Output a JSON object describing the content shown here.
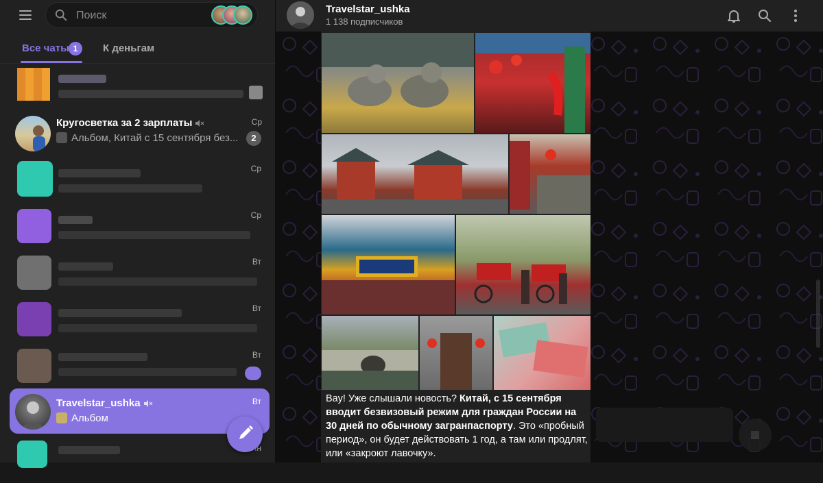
{
  "sidebar": {
    "search_placeholder": "Поиск",
    "tabs": [
      {
        "label": "Все чаты",
        "badge": "1"
      },
      {
        "label": "К деньгам"
      }
    ],
    "chats": [
      {
        "title": "Кругосветка за 2 зарплаты",
        "preview": "Альбом, Китай с 15 сентября без...",
        "time": "Ср",
        "unread": "2",
        "muted": true
      },
      {
        "title": "Travelstar_ushka",
        "preview": "Альбом",
        "time": "Вт",
        "muted": true,
        "active": true
      }
    ],
    "blurred_times": [
      "Ср",
      "Ср",
      "Вт",
      "Вт",
      "Вт",
      "Ин"
    ]
  },
  "header": {
    "title": "Travelstar_ushka",
    "subtitle": "1 138 подписчиков",
    "icons": [
      "bell-icon",
      "search-icon",
      "more-vertical-icon"
    ]
  },
  "message": {
    "caption_lead": "Вау! Уже слышали новость? ",
    "caption_bold": "Китай, с 15 сентября вводит безвизовый режим для граждан России на 30 дней по обычному загранпаспорту",
    "caption_tail": ". Это «пробный период», он будет действовать 1 год, а там или продлят, или «закроют лавочку»."
  },
  "colors": {
    "accent": "#8774e1",
    "sidebar_bg": "#212121",
    "chat_bg": "#0f0f0f",
    "text_secondary": "#aaaaaa"
  }
}
